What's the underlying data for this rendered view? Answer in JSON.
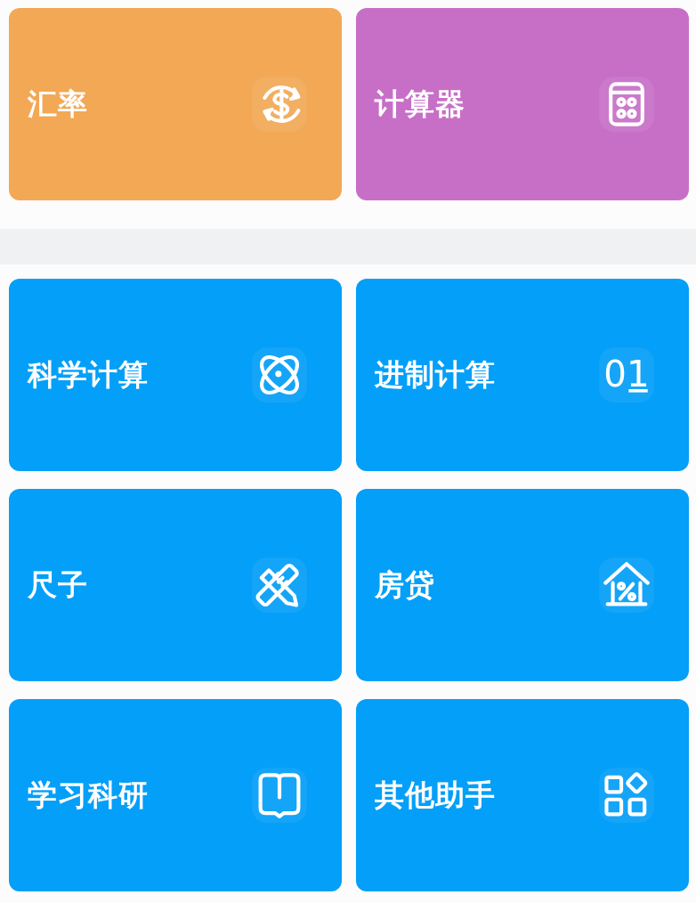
{
  "sections": [
    {
      "tiles": [
        {
          "label": "汇率",
          "kind": "exchange",
          "color": "#f2a855"
        },
        {
          "label": "计算器",
          "kind": "calculator",
          "color": "#c76fc7"
        }
      ]
    },
    {
      "tiles": [
        {
          "label": "科学计算",
          "kind": "science",
          "color": "#049ff8"
        },
        {
          "label": "进制计算",
          "kind": "binary",
          "icon_text": "01",
          "color": "#049ff8"
        },
        {
          "label": "尺子",
          "kind": "ruler",
          "color": "#049ff8"
        },
        {
          "label": "房贷",
          "kind": "loan",
          "color": "#049ff8"
        },
        {
          "label": "学习科研",
          "kind": "study",
          "color": "#049ff8"
        },
        {
          "label": "其他助手",
          "kind": "more",
          "color": "#049ff8"
        }
      ]
    }
  ]
}
